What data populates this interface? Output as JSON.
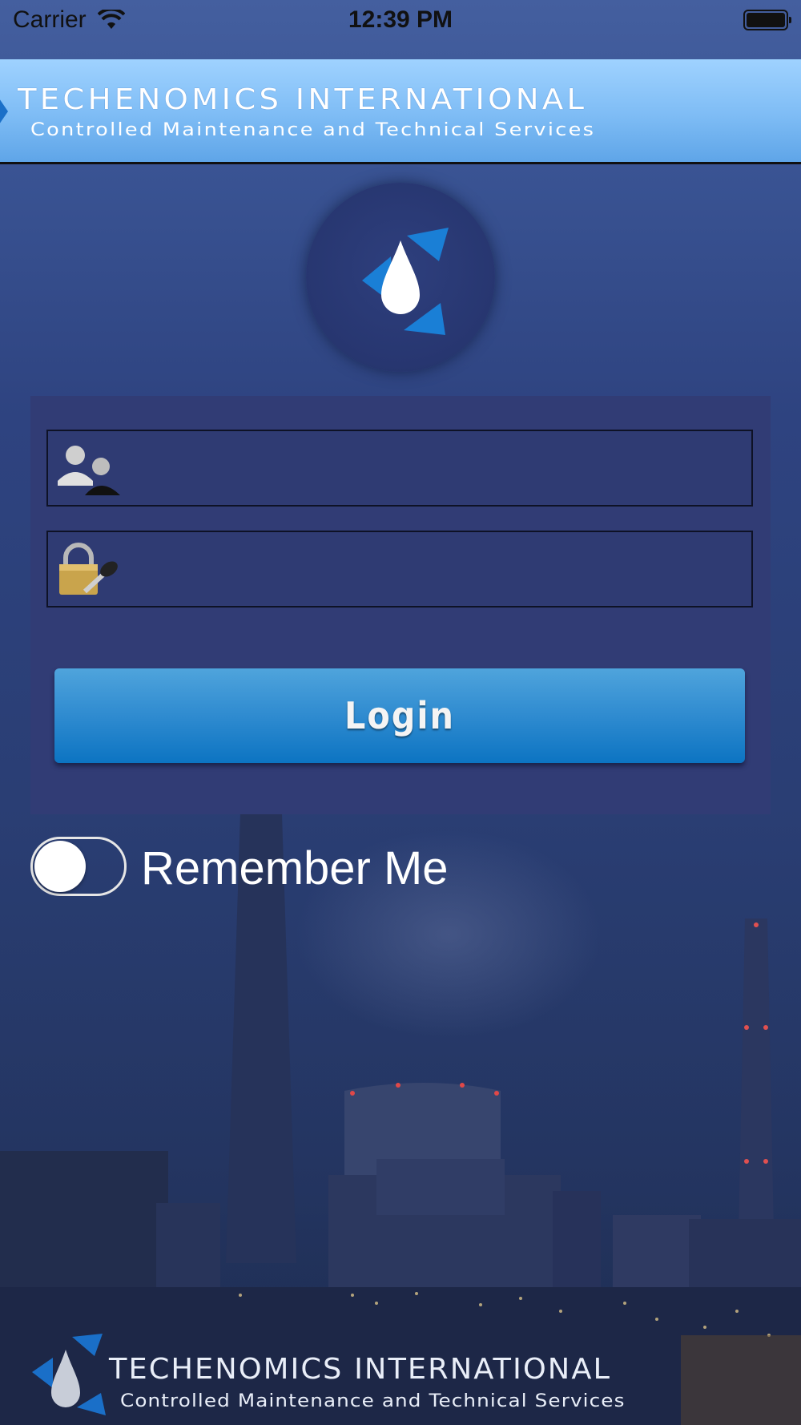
{
  "status_bar": {
    "carrier": "Carrier",
    "time": "12:39 PM"
  },
  "header": {
    "title": "TECHENOMICS INTERNATIONAL",
    "subtitle": "Controlled Maintenance and Technical Services"
  },
  "login": {
    "username_value": "",
    "password_value": "",
    "button_label": "Login"
  },
  "remember_me": {
    "label": "Remember Me",
    "enabled": false
  },
  "footer": {
    "title": "TECHENOMICS INTERNATIONAL",
    "subtitle": "Controlled Maintenance and Technical Services"
  },
  "colors": {
    "banner": "#7ebcf5",
    "panel": "#313c75",
    "button": "#0c74c2",
    "emblem_accent": "#1a7fd6"
  },
  "icons": [
    "wifi-icon",
    "battery-icon",
    "user-icon",
    "lock-key-icon",
    "techenomics-logo"
  ]
}
